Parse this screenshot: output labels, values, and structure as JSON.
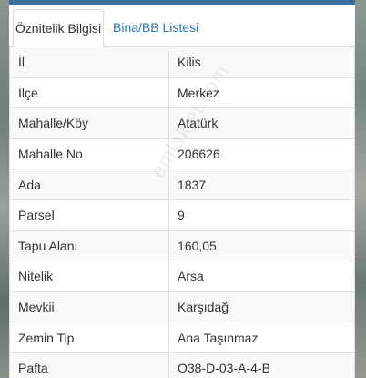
{
  "tabs": {
    "active_label": "Öznitelik Bilgisi",
    "inactive_label": "Bina/BB Listesi"
  },
  "rows": [
    {
      "key": "İl",
      "value": "Kilis"
    },
    {
      "key": "İlçe",
      "value": "Merkez"
    },
    {
      "key": "Mahalle/Köy",
      "value": "Atatürk"
    },
    {
      "key": "Mahalle No",
      "value": "206626"
    },
    {
      "key": "Ada",
      "value": "1837"
    },
    {
      "key": "Parsel",
      "value": "9"
    },
    {
      "key": "Tapu Alanı",
      "value": "160,05"
    },
    {
      "key": "Nitelik",
      "value": "Arsa"
    },
    {
      "key": "Mevkii",
      "value": "Karşıdağ"
    },
    {
      "key": "Zemin Tip",
      "value": "Ana Taşınmaz"
    },
    {
      "key": "Pafta",
      "value": "O38-D-03-A-4-B"
    }
  ],
  "watermark": "emlakjet.com",
  "colors": {
    "accent": "#3a6f9f",
    "tab_link": "#2a7ab8"
  }
}
